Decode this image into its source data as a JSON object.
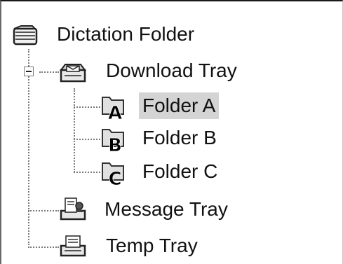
{
  "tree": {
    "root": {
      "label": "Dictation Folder",
      "icon": "dictation-folder-icon"
    },
    "download_tray": {
      "label": "Download Tray",
      "icon": "download-tray-icon",
      "expander": "collapse-toggle-icon",
      "folders": [
        {
          "label": "Folder A",
          "icon": "folder-a-icon",
          "letter": "A",
          "selected": true
        },
        {
          "label": "Folder B",
          "icon": "folder-b-icon",
          "letter": "B",
          "selected": false
        },
        {
          "label": "Folder C",
          "icon": "folder-c-icon",
          "letter": "C",
          "selected": false
        }
      ]
    },
    "message_tray": {
      "label": "Message Tray",
      "icon": "message-tray-icon"
    },
    "temp_tray": {
      "label": "Temp Tray",
      "icon": "temp-tray-icon"
    }
  },
  "colors": {
    "selection": "#d4d4d4",
    "text": "#111111"
  }
}
